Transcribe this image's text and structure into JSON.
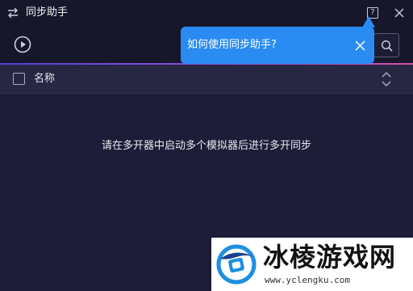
{
  "window": {
    "title": "同步助手",
    "help_glyph": "?",
    "icons": {
      "app": "sync-arrows-icon",
      "help": "help-icon",
      "close": "close-icon"
    }
  },
  "toolbar": {
    "icons": {
      "play": "play-icon",
      "search": "search-icon"
    }
  },
  "tooltip": {
    "text": "如何使用同步助手?",
    "background": "#2a8cf2"
  },
  "list": {
    "columns": [
      {
        "label": "名称"
      }
    ],
    "empty_message": "请在多开器中启动多个模拟器后进行多开同步"
  },
  "watermark": {
    "text": "冰棱游戏网",
    "url": "www.yclengku.com"
  },
  "colors": {
    "background": "#1d1d38",
    "header_row": "#272744",
    "accent_gradient": [
      "#5a3fd0",
      "#d84fa6"
    ]
  }
}
